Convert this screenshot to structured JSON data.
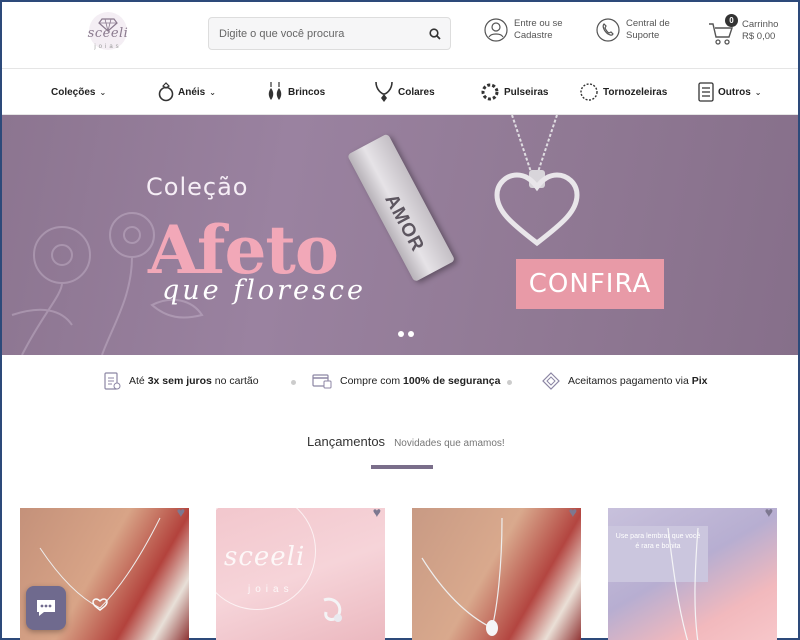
{
  "header": {
    "brand": "sceeli",
    "brand_sub": "joias",
    "search_placeholder": "Digite o que você procura",
    "login_line1": "Entre ou se",
    "login_line2": "Cadastre",
    "support_line1": "Central de",
    "support_line2": "Suporte",
    "cart_count": "0",
    "cart_label": "Carrinho",
    "cart_total": "R$ 0,00"
  },
  "nav": {
    "items": [
      {
        "label": "Coleções",
        "icon": "none",
        "dropdown": true
      },
      {
        "label": "Anéis",
        "icon": "ring-icon",
        "dropdown": true
      },
      {
        "label": "Brincos",
        "icon": "earrings-icon",
        "dropdown": false
      },
      {
        "label": "Colares",
        "icon": "necklace-icon",
        "dropdown": false
      },
      {
        "label": "Pulseiras",
        "icon": "bracelet-icon",
        "dropdown": false
      },
      {
        "label": "Tornozeleiras",
        "icon": "anklet-icon",
        "dropdown": false
      },
      {
        "label": "Outros",
        "icon": "list-icon",
        "dropdown": true
      }
    ]
  },
  "banner": {
    "line1": "Coleção",
    "line2": "Afeto",
    "line3": "que floresce",
    "tag_text": "AMOR",
    "cta": "CONFIRA"
  },
  "benefits": [
    {
      "pre": "Até ",
      "bold": "3x sem juros",
      "post": " no cartão",
      "icon": "invoice-icon"
    },
    {
      "pre": "Compre com ",
      "bold": "100% de segurança",
      "post": "",
      "icon": "secure-card-icon"
    },
    {
      "pre": "Aceitamos pagamento via ",
      "bold": "Pix",
      "post": "",
      "icon": "pix-icon"
    }
  ],
  "section": {
    "title": "Lançamentos",
    "subtitle": "Novidades que amamos!"
  },
  "products": {
    "p2_brand": "sceeli",
    "p2_sub": "joias",
    "p4_card": "Use para lembrar que você é rara e bonita"
  },
  "colors": {
    "accent": "#7a6e8a",
    "banner_bg": "#917a95",
    "cta_bg": "#e89aa7",
    "chat_bg": "#6f6a8e"
  }
}
